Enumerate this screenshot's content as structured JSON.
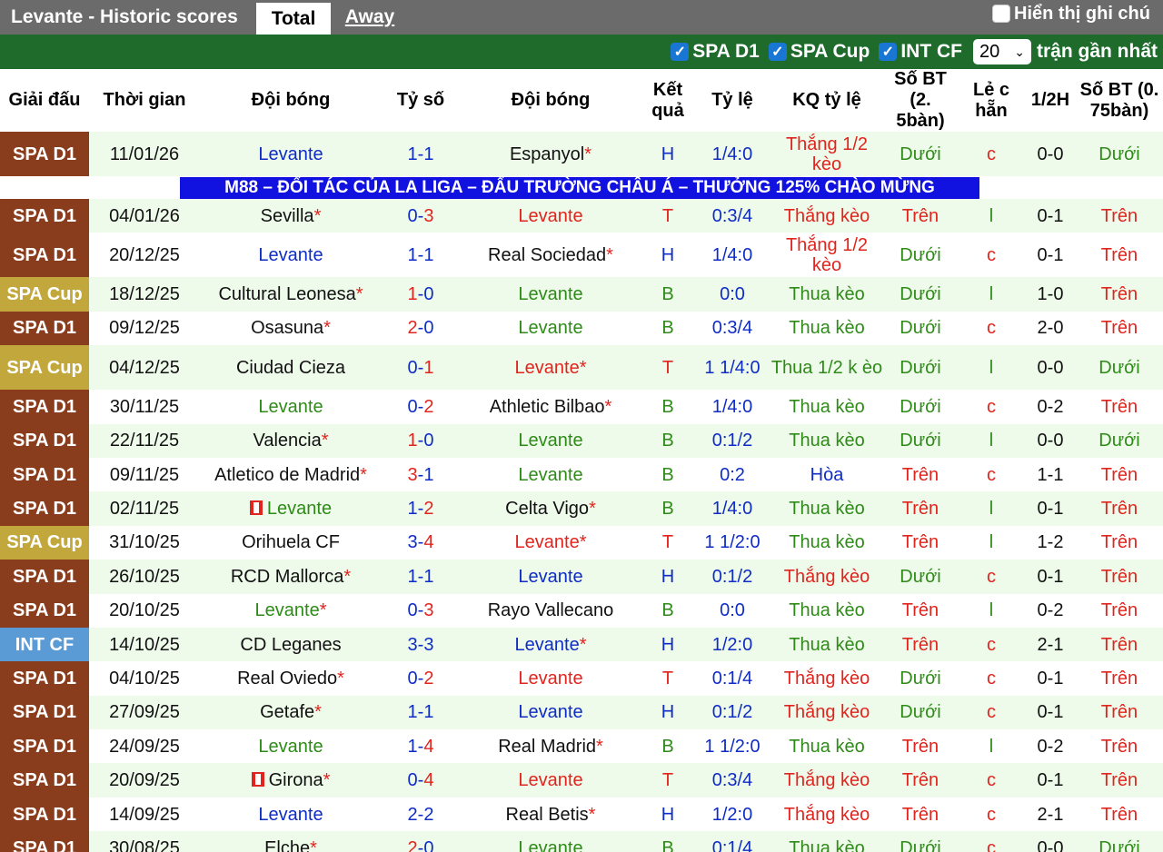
{
  "header": {
    "title": "Levante - Historic scores",
    "tabs": [
      "Total",
      "Away"
    ],
    "show_notes_label": "Hiển thị ghi chú"
  },
  "filters": {
    "items": [
      "SPA D1",
      "SPA Cup",
      "INT CF"
    ],
    "select_value": "20",
    "recent_label": "trận gần nhất"
  },
  "columns": [
    "Giải đấu",
    "Thời gian",
    "Đội bóng",
    "Tỷ số",
    "Đội bóng",
    "Kết quả",
    "Tỷ lệ",
    "KQ tỷ lệ",
    "Số BT (2. 5bàn)",
    "Lẻ c hẵn",
    "1/2H",
    "Số BT (0. 75bàn)"
  ],
  "banner": "M88 – ĐỐI TÁC CỦA LA LIGA – ĐẤU TRƯỜNG CHÂU Á – THƯỞNG 125% CHÀO MỪNG",
  "colors": {
    "spa_d1": "#8a3d1c",
    "spa_cup": "#c2a83c",
    "int_cf": "#5b9bd5",
    "header_green": "#1e6b2c",
    "banner_blue": "#1111e0"
  },
  "matches": [
    {
      "league": "SPA D1",
      "date": "11/01/26",
      "home": "Levante",
      "score": "1-1",
      "away": "Espanyol*",
      "result": "H",
      "odds": "1/4:0",
      "odds_result": "Thắng 1/2 kèo",
      "ou": "Dưới",
      "oe": "c",
      "half": "0-0",
      "ou2": "Dưới"
    },
    {
      "league": "SPA D1",
      "date": "04/01/26",
      "home": "Sevilla*",
      "score": "0-3",
      "away": "Levante",
      "result": "T",
      "odds": "0:3/4",
      "odds_result": "Thắng kèo",
      "ou": "Trên",
      "oe": "l",
      "half": "0-1",
      "ou2": "Trên"
    },
    {
      "league": "SPA D1",
      "date": "20/12/25",
      "home": "Levante",
      "score": "1-1",
      "away": "Real Sociedad*",
      "result": "H",
      "odds": "1/4:0",
      "odds_result": "Thắng 1/2 kèo",
      "ou": "Dưới",
      "oe": "c",
      "half": "0-1",
      "ou2": "Trên"
    },
    {
      "league": "SPA Cup",
      "date": "18/12/25",
      "home": "Cultural Leonesa*",
      "score": "1-0",
      "away": "Levante",
      "result": "B",
      "odds": "0:0",
      "odds_result": "Thua kèo",
      "ou": "Dưới",
      "oe": "l",
      "half": "1-0",
      "ou2": "Trên"
    },
    {
      "league": "SPA D1",
      "date": "09/12/25",
      "home": "Osasuna*",
      "score": "2-0",
      "away": "Levante",
      "result": "B",
      "odds": "0:3/4",
      "odds_result": "Thua kèo",
      "ou": "Dưới",
      "oe": "c",
      "half": "2-0",
      "ou2": "Trên"
    },
    {
      "league": "SPA Cup",
      "date": "04/12/25",
      "home": "Ciudad Cieza",
      "score": "0-1",
      "away": "Levante*",
      "result": "T",
      "odds": "1 1/4:0",
      "odds_result": "Thua 1/2 k èo",
      "ou": "Dưới",
      "oe": "l",
      "half": "0-0",
      "ou2": "Dưới"
    },
    {
      "league": "SPA D1",
      "date": "30/11/25",
      "home": "Levante",
      "score": "0-2",
      "away": "Athletic Bilbao*",
      "result": "B",
      "odds": "1/4:0",
      "odds_result": "Thua kèo",
      "ou": "Dưới",
      "oe": "c",
      "half": "0-2",
      "ou2": "Trên"
    },
    {
      "league": "SPA D1",
      "date": "22/11/25",
      "home": "Valencia*",
      "score": "1-0",
      "away": "Levante",
      "result": "B",
      "odds": "0:1/2",
      "odds_result": "Thua kèo",
      "ou": "Dưới",
      "oe": "l",
      "half": "0-0",
      "ou2": "Dưới"
    },
    {
      "league": "SPA D1",
      "date": "09/11/25",
      "home": "Atletico de Madrid*",
      "score": "3-1",
      "away": "Levante",
      "result": "B",
      "odds": "0:2",
      "odds_result": "Hòa",
      "ou": "Trên",
      "oe": "c",
      "half": "1-1",
      "ou2": "Trên"
    },
    {
      "league": "SPA D1",
      "date": "02/11/25",
      "home": "Levante",
      "score": "1-2",
      "away": "Celta Vigo*",
      "result": "B",
      "odds": "1/4:0",
      "odds_result": "Thua kèo",
      "ou": "Trên",
      "oe": "l",
      "half": "0-1",
      "ou2": "Trên"
    },
    {
      "league": "SPA Cup",
      "date": "31/10/25",
      "home": "Orihuela CF",
      "score": "3-4",
      "away": "Levante*",
      "result": "T",
      "odds": "1 1/2:0",
      "odds_result": "Thua kèo",
      "ou": "Trên",
      "oe": "l",
      "half": "1-2",
      "ou2": "Trên"
    },
    {
      "league": "SPA D1",
      "date": "26/10/25",
      "home": "RCD Mallorca*",
      "score": "1-1",
      "away": "Levante",
      "result": "H",
      "odds": "0:1/2",
      "odds_result": "Thắng kèo",
      "ou": "Dưới",
      "oe": "c",
      "half": "0-1",
      "ou2": "Trên"
    },
    {
      "league": "SPA D1",
      "date": "20/10/25",
      "home": "Levante*",
      "score": "0-3",
      "away": "Rayo Vallecano",
      "result": "B",
      "odds": "0:0",
      "odds_result": "Thua kèo",
      "ou": "Trên",
      "oe": "l",
      "half": "0-2",
      "ou2": "Trên"
    },
    {
      "league": "INT CF",
      "date": "14/10/25",
      "home": "CD Leganes",
      "score": "3-3",
      "away": "Levante*",
      "result": "H",
      "odds": "1/2:0",
      "odds_result": "Thua kèo",
      "ou": "Trên",
      "oe": "c",
      "half": "2-1",
      "ou2": "Trên"
    },
    {
      "league": "SPA D1",
      "date": "04/10/25",
      "home": "Real Oviedo*",
      "score": "0-2",
      "away": "Levante",
      "result": "T",
      "odds": "0:1/4",
      "odds_result": "Thắng kèo",
      "ou": "Dưới",
      "oe": "c",
      "half": "0-1",
      "ou2": "Trên"
    },
    {
      "league": "SPA D1",
      "date": "27/09/25",
      "home": "Getafe*",
      "score": "1-1",
      "away": "Levante",
      "result": "H",
      "odds": "0:1/2",
      "odds_result": "Thắng kèo",
      "ou": "Dưới",
      "oe": "c",
      "half": "0-1",
      "ou2": "Trên"
    },
    {
      "league": "SPA D1",
      "date": "24/09/25",
      "home": "Levante",
      "score": "1-4",
      "away": "Real Madrid*",
      "result": "B",
      "odds": "1 1/2:0",
      "odds_result": "Thua kèo",
      "ou": "Trên",
      "oe": "l",
      "half": "0-2",
      "ou2": "Trên"
    },
    {
      "league": "SPA D1",
      "date": "20/09/25",
      "home": "Girona*",
      "score": "0-4",
      "away": "Levante",
      "result": "T",
      "odds": "0:3/4",
      "odds_result": "Thắng kèo",
      "ou": "Trên",
      "oe": "c",
      "half": "0-1",
      "ou2": "Trên"
    },
    {
      "league": "SPA D1",
      "date": "14/09/25",
      "home": "Levante",
      "score": "2-2",
      "away": "Real Betis*",
      "result": "H",
      "odds": "1/2:0",
      "odds_result": "Thắng kèo",
      "ou": "Trên",
      "oe": "c",
      "half": "2-1",
      "ou2": "Trên"
    },
    {
      "league": "SPA D1",
      "date": "30/08/25",
      "home": "Elche*",
      "score": "2-0",
      "away": "Levante",
      "result": "B",
      "odds": "0:1/4",
      "odds_result": "Thua kèo",
      "ou": "Dưới",
      "oe": "c",
      "half": "0-0",
      "ou2": "Dưới"
    }
  ]
}
